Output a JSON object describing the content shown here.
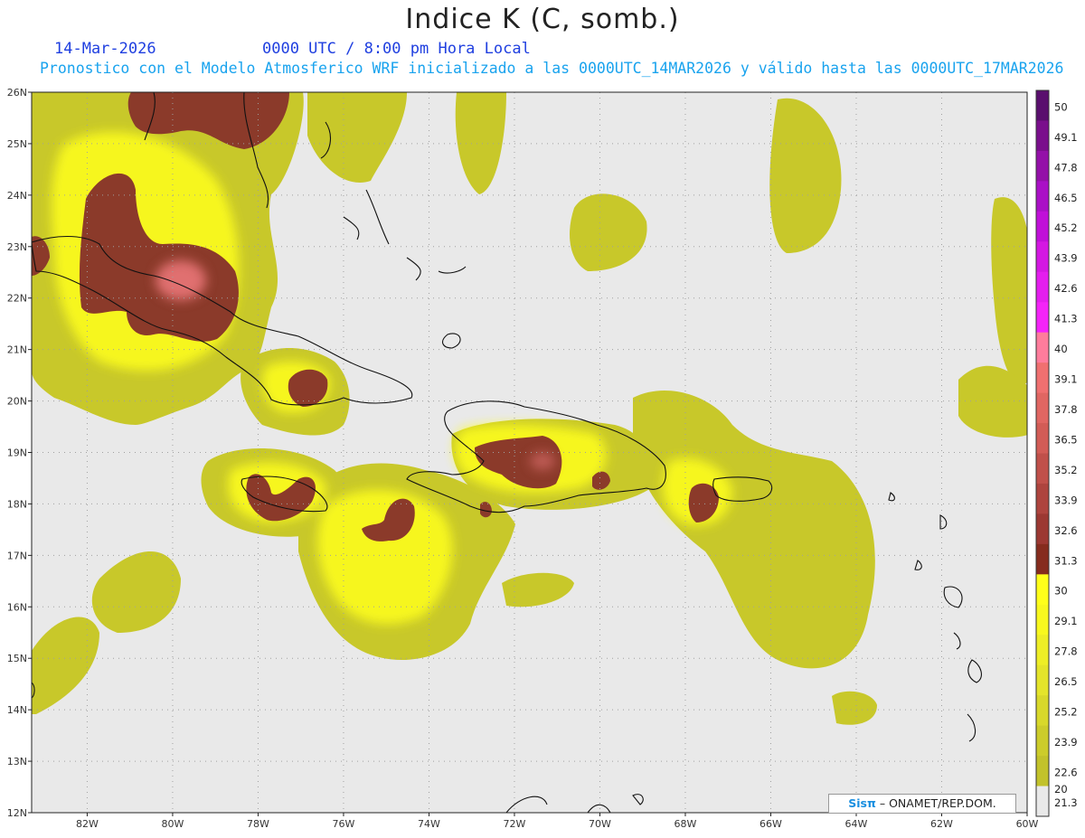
{
  "header": {
    "title": "Indice K (C, somb.)",
    "date": "14-Mar-2026",
    "time": "0000 UTC / 8:00 pm Hora Local",
    "description": "Pronostico con el Modelo Atmosferico WRF inicializado a las 0000UTC_14MAR2026 y válido hasta las  0000UTC_17MAR2026"
  },
  "axes": {
    "lat_labels": [
      "26N",
      "25N",
      "24N",
      "23N",
      "22N",
      "21N",
      "20N",
      "19N",
      "18N",
      "17N",
      "16N",
      "15N",
      "14N",
      "13N",
      "12N"
    ],
    "lon_labels": [
      "82W",
      "80W",
      "78W",
      "76W",
      "74W",
      "72W",
      "70W",
      "68W",
      "66W",
      "64W",
      "62W",
      "60W"
    ],
    "lat_range": [
      12,
      26
    ],
    "lon_range": [
      -83.3,
      -60
    ]
  },
  "colorbar": {
    "labels": [
      "50",
      "49.1",
      "47.8",
      "46.5",
      "45.2",
      "43.9",
      "42.6",
      "41.3",
      "40",
      "39.1",
      "37.8",
      "36.5",
      "35.2",
      "33.9",
      "32.6",
      "31.3",
      "30",
      "29.1",
      "27.8",
      "26.5",
      "25.2",
      "23.9",
      "22.6",
      "21.3",
      "20"
    ],
    "colors": [
      "#5a0f6e",
      "#7a0f8c",
      "#9410a8",
      "#aa10c6",
      "#c010d8",
      "#d418e2",
      "#e41eee",
      "#f424f8",
      "#ff7c9c",
      "#f07070",
      "#e06662",
      "#d25c56",
      "#c0504a",
      "#ae443e",
      "#9c3832",
      "#862c1e",
      "#ffff1a",
      "#f8f81e",
      "#eeee26",
      "#e4e42a",
      "#d8d82a",
      "#cccc2a",
      "#c2c22a",
      "#e9e9e9"
    ]
  },
  "legend": {
    "highlight_colors": {
      "dark": "#8b3a2a",
      "light": "#e07070",
      "yellow": "#ffff1a",
      "olive": "#c8c82a",
      "background": "#e9e9e9"
    }
  },
  "credit": {
    "logo": "Sisπ",
    "text": "– ONAMET/REP.DOM."
  }
}
